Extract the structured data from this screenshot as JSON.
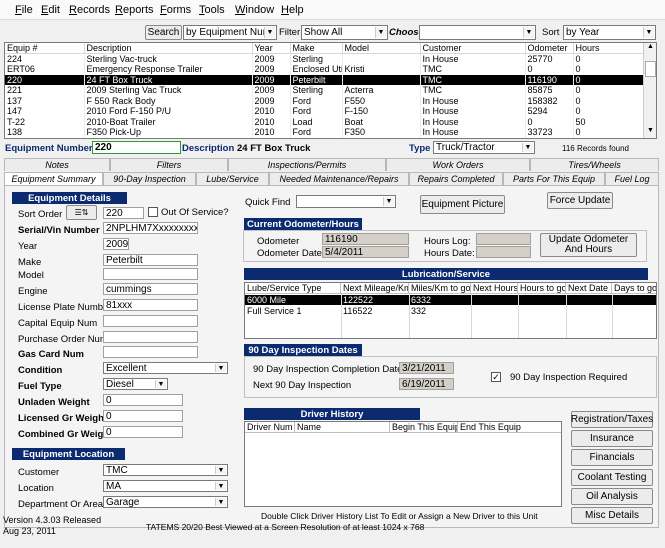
{
  "menu": [
    "File",
    "Edit",
    "Records",
    "Reports",
    "Forms",
    "Tools",
    "Window",
    "Help"
  ],
  "toolbar": {
    "search_label": "Search",
    "search_by": "by Equipment Num",
    "filter_label": "Filter",
    "filter_value": "Show All",
    "choose_label": "Choose",
    "choose_value": "",
    "sort_label": "Sort",
    "sort_value": "by Year"
  },
  "grid": {
    "columns": [
      "Equip #",
      "Description",
      "Year",
      "Make",
      "Model",
      "Customer",
      "Odometer",
      "Hours"
    ],
    "rows": [
      [
        "224",
        "Sterling Vac-truck",
        "2009",
        "Sterling",
        "",
        "In House",
        "25770",
        "0"
      ],
      [
        "ERT06",
        "Emergency Response Trailer",
        "2009",
        "Enclosed Utili",
        "Kristi",
        "TMC",
        "0",
        "0"
      ],
      [
        "220",
        "24 FT Box Truck",
        "2009",
        "Peterbilt",
        "",
        "TMC",
        "116190",
        "0"
      ],
      [
        "221",
        "2009 Sterling Vac Truck",
        "2009",
        "Sterling",
        "Acterra",
        "TMC",
        "85875",
        "0"
      ],
      [
        "137",
        "F 550 Rack Body",
        "2009",
        "Ford",
        "F550",
        "In House",
        "158382",
        "0"
      ],
      [
        "147",
        "2010 Ford F-150 P/U",
        "2010",
        "Ford",
        "F-150",
        "In House",
        "5294",
        "0"
      ],
      [
        "T-22",
        "2010-Boat Trailer",
        "2010",
        "Load",
        "Boat",
        "In House",
        "0",
        "50"
      ],
      [
        "138",
        "F350 Pick-Up",
        "2010",
        "Ford",
        "F350",
        "In House",
        "33723",
        "0"
      ]
    ],
    "selected_index": 2
  },
  "equip_line": {
    "number_label": "Equipment Number",
    "number_value": "220",
    "desc_label": "Description",
    "desc_value": "24 FT Box Truck",
    "type_label": "Type",
    "type_value": "Truck/Tractor",
    "records_found": "116 Records found"
  },
  "tabs_row1": [
    "Notes",
    "Filters",
    "Inspections/Permits",
    "Work Orders",
    "Tires/Wheels"
  ],
  "tabs_row2": [
    "Equipment Summary",
    "90-Day Inspection",
    "Lube/Service",
    "Needed Maintenance/Repairs",
    "Repairs Completed",
    "Parts For This Equip",
    "Fuel Log"
  ],
  "details": {
    "title": "Equipment Details",
    "sort_order_label": "Sort Order",
    "sort_order_value": "220",
    "out_of_service_label": "Out Of Service?",
    "serial_label": "Serial/Vin Number",
    "serial_value": "2NPLHM7Xxxxxxxxxxxx",
    "year_label": "Year",
    "year_value": "2009",
    "make_label": "Make",
    "make_value": "Peterbilt",
    "model_label": "Model",
    "model_value": "",
    "engine_label": "Engine",
    "engine_value": "cummings",
    "plate_label": "License Plate Number",
    "plate_value": "81xxx",
    "capital_label": "Capital Equip Num",
    "capital_value": "",
    "po_label": "Purchase Order Num",
    "po_value": "",
    "gascard_label": "Gas Card Num",
    "gascard_value": "",
    "condition_label": "Condition",
    "condition_value": "Excellent",
    "fuel_label": "Fuel Type",
    "fuel_value": "Diesel",
    "unladen_label": "Unladen Weight",
    "unladen_value": "0",
    "licensed_label": "Licensed Gr Weight",
    "licensed_value": "0",
    "combined_label": "Combined Gr Weight",
    "combined_value": "0"
  },
  "location": {
    "title": "Equipment Location",
    "customer_label": "Customer",
    "customer_value": "TMC",
    "location_label": "Location",
    "location_value": "MA",
    "dept_label": "Department Or Area",
    "dept_value": "Garage"
  },
  "quickfind": {
    "label": "Quick Find",
    "value": "",
    "picture_button": "Equipment Picture",
    "force_update_button": "Force Update"
  },
  "odometer": {
    "title": "Current Odometer/Hours",
    "odometer_label": "Odometer",
    "odometer_value": "116190",
    "odometer_date_label": "Odometer Date",
    "odometer_date_value": "5/4/2011",
    "hours_log_label": "Hours Log:",
    "hours_log_value": "",
    "hours_date_label": "Hours Date:",
    "hours_date_value": "",
    "update_button_line1": "Update Odometer",
    "update_button_line2": "And  Hours"
  },
  "lube": {
    "title": "Lubrication/Service",
    "columns": [
      "Lube/Service Type",
      "Next Mileage/Km",
      "Miles/Km to go",
      "Next Hours",
      "Hours to go",
      "Next Date",
      "Days to go"
    ],
    "rows": [
      [
        "6000 Mile",
        "122522",
        "6332",
        "",
        "",
        "",
        ""
      ],
      [
        "Full Service 1",
        "116522",
        "332",
        "",
        "",
        "",
        ""
      ]
    ],
    "selected_index": 0
  },
  "inspection": {
    "title": "90 Day Inspection Dates",
    "completion_label": "90 Day Inspection Completion Date",
    "completion_value": "3/21/2011",
    "next_label": "Next 90 Day Inspection",
    "next_value": "6/19/2011",
    "required_label": "90 Day Inspection Required",
    "required_checked": true
  },
  "driver": {
    "title": "Driver History",
    "columns": [
      "Driver Num",
      "Name",
      "Begin This Equip",
      "End This Equip"
    ],
    "hint": "Double Click Driver History List To Edit or Assign a New Driver to this Unit"
  },
  "side_buttons": [
    "Registration/Taxes",
    "Insurance",
    "Financials",
    "Coolant Testing",
    "Oil Analysis",
    "Misc Details"
  ],
  "footer": {
    "version": "Version 4.3.03 Released",
    "date": "Aug 23,  2011",
    "resolution_note": "TATEMS 20/20 Best Viewed at a Screen Resolution of at least 1024 x 768"
  },
  "colors": {
    "panel_header": "#0b2a6f",
    "selected_row": "#000000"
  }
}
